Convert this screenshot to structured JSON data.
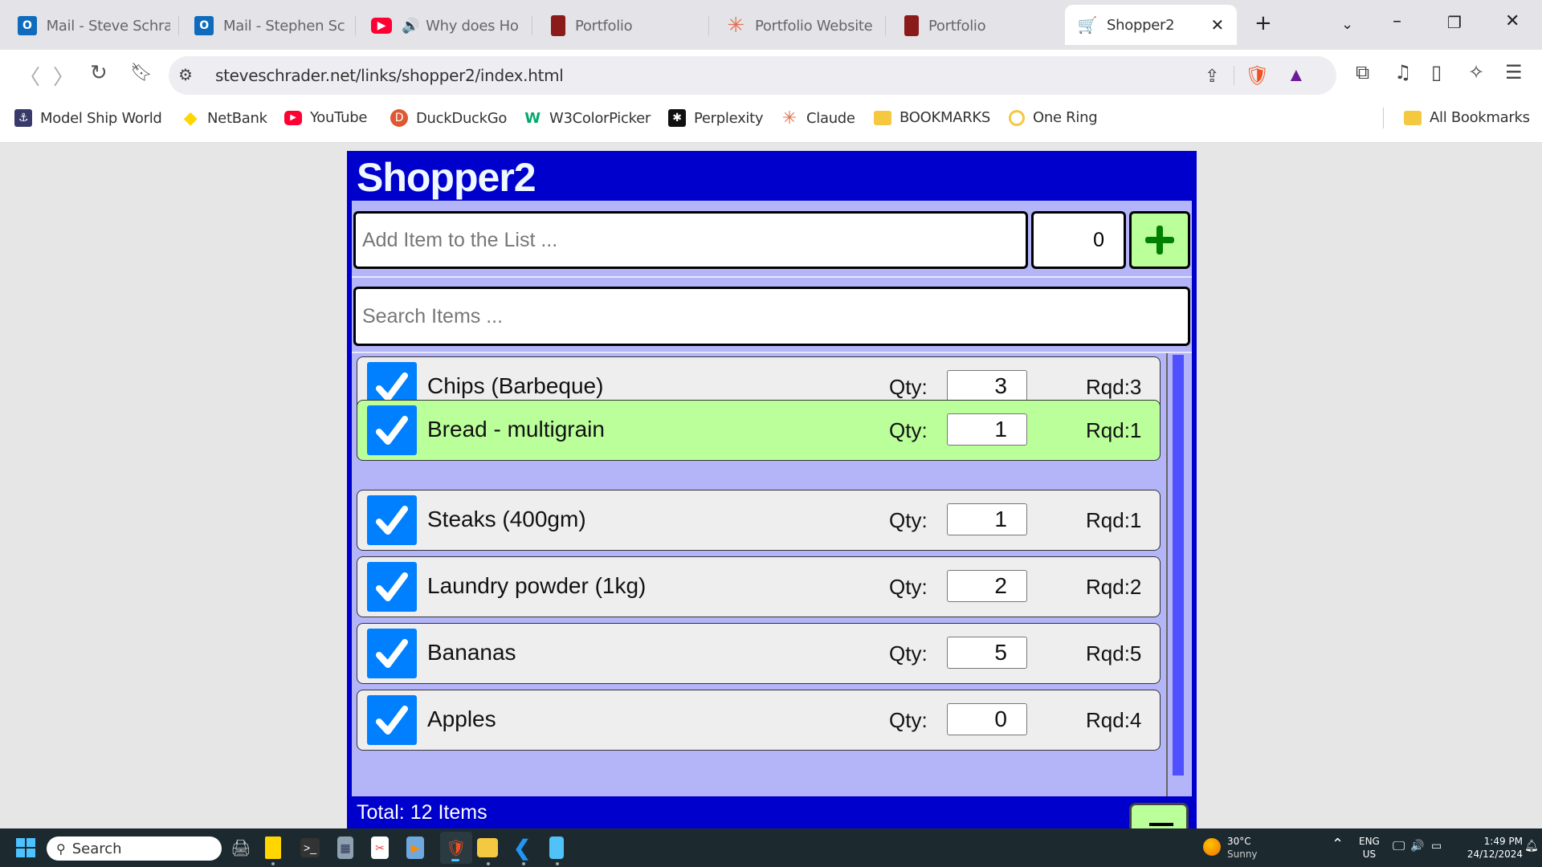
{
  "browser": {
    "tabs": [
      {
        "label": "Mail - Steve Schra",
        "icon": "outlook-icon"
      },
      {
        "label": "Mail - Stephen Sc",
        "icon": "outlook-icon"
      },
      {
        "label": "Why does Ho",
        "icon": "youtube-icon",
        "audio": true
      },
      {
        "label": "Portfolio",
        "icon": "portfolio-book-icon"
      },
      {
        "label": "Portfolio Website",
        "icon": "claude-icon"
      },
      {
        "label": "Portfolio",
        "icon": "portfolio-book-icon"
      },
      {
        "label": "Shopper2",
        "icon": "shopping-cart-icon",
        "active": true
      }
    ],
    "new_tab_label": "+",
    "address": "steveschrader.net/links/shopper2/index.html",
    "bookmarks": [
      {
        "label": "Model Ship World",
        "icon": "model-ship-world-icon"
      },
      {
        "label": "NetBank",
        "icon": "netbank-icon"
      },
      {
        "label": "YouTube",
        "icon": "youtube-icon"
      },
      {
        "label": "DuckDuckGo",
        "icon": "duckduckgo-icon"
      },
      {
        "label": "W3ColorPicker",
        "icon": "w3-icon"
      },
      {
        "label": "Perplexity",
        "icon": "perplexity-icon"
      },
      {
        "label": "Claude",
        "icon": "claude-icon"
      },
      {
        "label": "BOOKMARKS",
        "icon": "folder-icon"
      },
      {
        "label": "One Ring",
        "icon": "ring-icon"
      }
    ],
    "all_bookmarks_label": "All Bookmarks"
  },
  "app": {
    "title": "Shopper2",
    "add_item": {
      "placeholder": "Add Item to the List ...",
      "qty": "0",
      "add_button_icon": "plus-icon"
    },
    "search": {
      "placeholder": "Search Items ..."
    },
    "qty_label": "Qty:",
    "items": [
      {
        "name": "Chips (Barbeque)",
        "qty": "3",
        "rqd": "Rqd:3",
        "checked": true,
        "done": false
      },
      {
        "name": "Bread - multigrain",
        "qty": "1",
        "rqd": "Rqd:1",
        "checked": true,
        "done": true
      },
      {
        "name": "Steaks (400gm)",
        "qty": "1",
        "rqd": "Rqd:1",
        "checked": true,
        "done": false
      },
      {
        "name": "Laundry powder (1kg)",
        "qty": "2",
        "rqd": "Rqd:2",
        "checked": true,
        "done": false
      },
      {
        "name": "Bananas",
        "qty": "5",
        "rqd": "Rqd:5",
        "checked": true,
        "done": false
      },
      {
        "name": "Apples",
        "qty": "0",
        "rqd": "Rqd:4",
        "checked": true,
        "done": false
      }
    ],
    "total": "Total: 12 Items",
    "colors": {
      "header": "#0000cd",
      "body": "#b4b4f8",
      "done_row": "#baff9a",
      "checkbox": "#0080ff",
      "add_button": "#baff9a",
      "plus": "#008000"
    }
  },
  "taskbar": {
    "search_label": "Search",
    "weather": {
      "temp": "30°C",
      "condition": "Sunny"
    },
    "language": {
      "line1": "ENG",
      "line2": "US"
    },
    "time": "1:49 PM",
    "date": "24/12/2024"
  }
}
